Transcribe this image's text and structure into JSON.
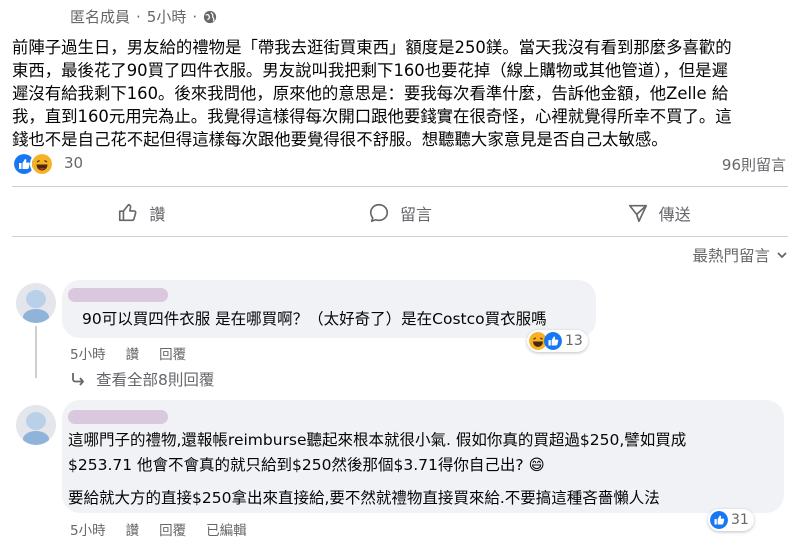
{
  "post": {
    "author": "匿名成員",
    "separator": "·",
    "time": "5小時",
    "privacy_icon": "globe-icon",
    "lines": [
      "前陣子過生日，男友給的禮物是「帶我去逛街買東西」額度是250鎂。當天我沒有看到那麼多喜歡的",
      "東西，最後花了90買了四件衣服。男友說叫我把剩下160也要花掉（線上購物或其他管道），但是遲",
      "遲沒有給我剩下160。後來我問他，原來他的意思是：要我每次看準什麼，告訴他金額，他Zelle 給",
      "我，直到160元用完為止。我覺得這樣得每次開口跟他要錢實在很奇怪，心裡就覺得所幸不買了。這",
      "錢也不是自己花不起但得這樣每次跟他要覺得很不舒服。想聽聽大家意見是否自己太敏感。"
    ],
    "reaction_count": "30",
    "comment_count": "96則留言"
  },
  "actions": {
    "like": "讚",
    "comment": "留言",
    "share": "傳送"
  },
  "sort_label": "最熱門留言",
  "comments": [
    {
      "text": "90可以買四件衣服 是在哪買啊？（太好奇了）是在Costco買衣服嗎",
      "time": "5小時",
      "like": "讚",
      "reply": "回覆",
      "reaction_count": "13",
      "view_replies": "查看全部8則回覆"
    },
    {
      "lines": [
        "這哪門子的禮物,還報帳reimburse聽起來根本就很小氣. 假如你真的買超過$250,譬如買成",
        "$253.71 他會不會真的就只給到$250然後那個$3.71得你自己出? 😄"
      ],
      "line3": "要給就大方的直接$250拿出來直接給,要不然就禮物直接買來給.不要搞這種吝嗇懶人法",
      "time": "5小時",
      "like": "讚",
      "reply": "回覆",
      "edited": "已編輯",
      "reaction_count": "31"
    }
  ],
  "colors": {
    "like_blue": "#1877f2",
    "haha_yellow": "#f7b125",
    "meta_gray": "#65676b",
    "bubble_bg": "#f0f2f5"
  }
}
